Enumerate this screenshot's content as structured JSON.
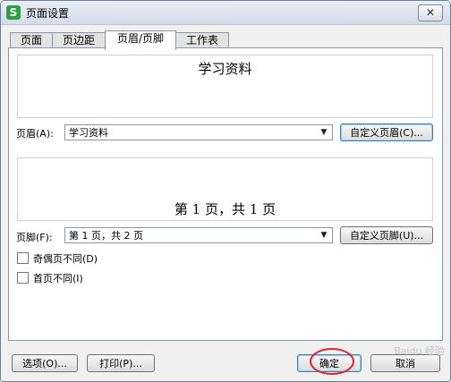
{
  "window": {
    "title": "页面设置",
    "app_icon": "S",
    "close_glyph": "✕"
  },
  "tabs": [
    {
      "label": "页面",
      "active": false
    },
    {
      "label": "页边距",
      "active": false
    },
    {
      "label": "页眉/页脚",
      "active": true
    },
    {
      "label": "工作表",
      "active": false
    }
  ],
  "header": {
    "preview_text": "学习资料",
    "label": "页眉(A):",
    "selected": "学习资料",
    "custom_button": "自定义页眉(C)..."
  },
  "footer": {
    "preview_text": "第 1 页，共 1 页",
    "label": "页脚(F):",
    "selected": "第 1 页，共 2 页",
    "custom_button": "自定义页脚(U)..."
  },
  "options": {
    "odd_even": {
      "label": "奇偶页不同(D)",
      "checked": false
    },
    "first_page": {
      "label": "首页不同(I)",
      "checked": false
    }
  },
  "bottom_buttons": {
    "options": "选项(O)...",
    "print": "打印(P)...",
    "ok": "确定",
    "cancel": "取消"
  },
  "watermark": "Baidu 经验"
}
